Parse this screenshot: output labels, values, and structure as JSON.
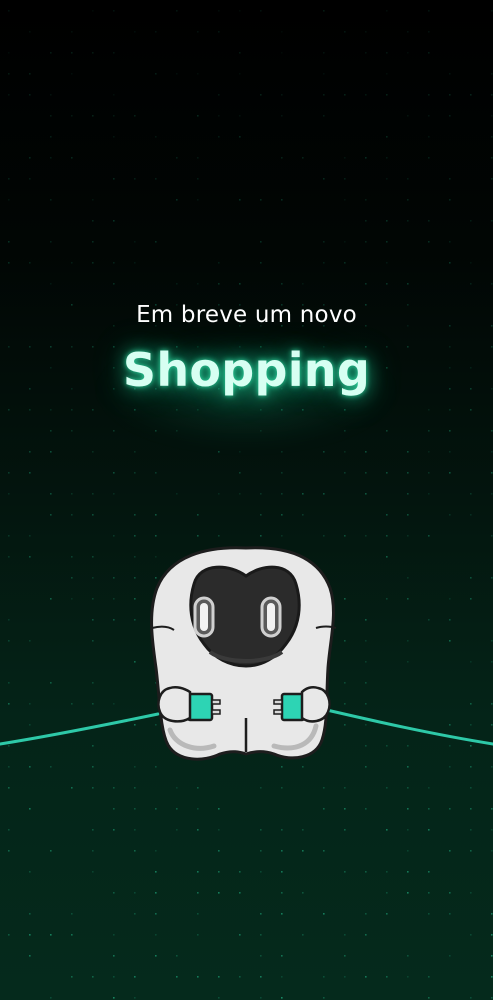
{
  "hero": {
    "subtitle": "Em breve um novo",
    "title": "Shopping"
  },
  "colors": {
    "background_top": "#000000",
    "background_bottom": "#052a1c",
    "dot_accent": "#1fa87c",
    "title_glow": "#3cffbe",
    "cable": "#2ec9a8",
    "plug": "#2dd4b4",
    "robot_body": "#e8e8e8",
    "robot_visor": "#2b2b2b"
  },
  "illustration": {
    "icon": "robot-mascot-icon",
    "holding": "cable-plug-icon"
  }
}
